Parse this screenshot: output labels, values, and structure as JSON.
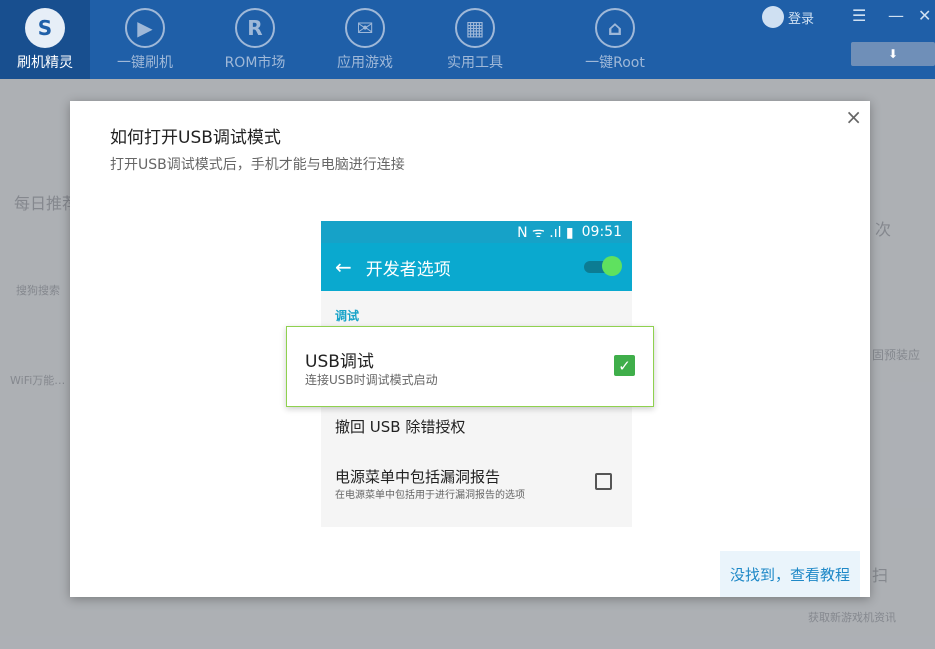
{
  "nav": {
    "items": [
      {
        "label": "刷机精灵",
        "glyph": "S"
      },
      {
        "label": "一键刷机",
        "glyph": "▶"
      },
      {
        "label": "ROM市场",
        "glyph": "R"
      },
      {
        "label": "应用游戏",
        "glyph": "✉"
      },
      {
        "label": "实用工具",
        "glyph": "▦"
      },
      {
        "label": "一键Root",
        "glyph": "⌂"
      }
    ],
    "login": "登录"
  },
  "background": {
    "daily": "每日推荐",
    "app1": "搜狗搜索",
    "app2": "WiFi万能…",
    "right1": "次",
    "right2": "固预装应",
    "right3": "扫",
    "right4": "获取新游戏机资讯"
  },
  "dialog": {
    "title": "如何打开USB调试模式",
    "subtitle": "打开USB调试模式后，手机才能与电脑进行连接",
    "close": "×",
    "help_link": "没找到，查看教程"
  },
  "phone": {
    "time": "09:51",
    "status_icons": "N ᯤ .ıl ▮",
    "appbar_title": "开发者选项",
    "section": "调试",
    "revoke": "撤回 USB 除错授权",
    "power_title": "电源菜单中包括漏洞报告",
    "power_sub": "在电源菜单中包括用于进行漏洞报告的选项"
  },
  "highlight": {
    "title": "USB调试",
    "subtitle": "连接USB时调试模式启动",
    "checked": true
  }
}
